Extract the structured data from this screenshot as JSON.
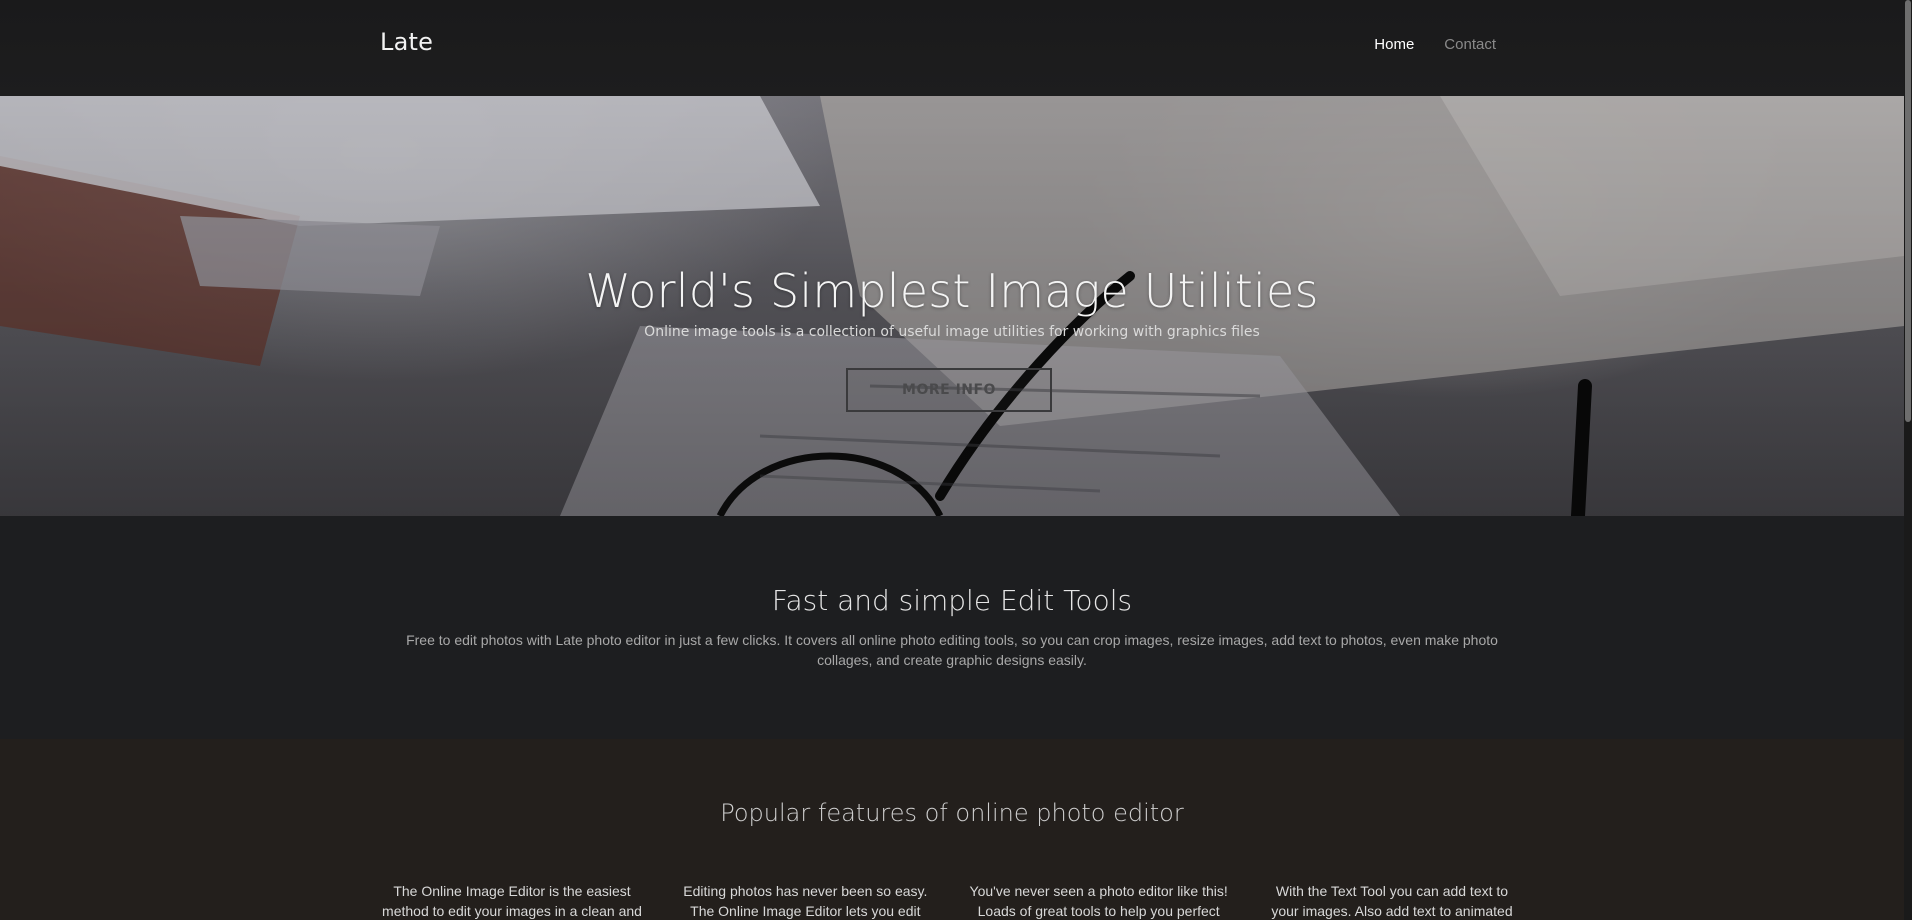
{
  "navbar": {
    "brand": "Late",
    "links": [
      {
        "label": "Home",
        "active": true
      },
      {
        "label": "Contact",
        "active": false
      }
    ]
  },
  "hero": {
    "heading": "World's Simplest Image Utilities",
    "subheading": "Online image tools is a collection of useful image utilities for working with graphics files",
    "button_label": "MORE INFO"
  },
  "tools": {
    "heading": "Fast and simple Edit Tools",
    "text": "Free to edit photos with Late photo editor in just a few clicks. It covers all online photo editing tools, so you can crop images, resize images, add text to photos, even make photo collages, and create graphic designs easily."
  },
  "features": {
    "heading": "Popular features of online photo editor",
    "columns": [
      {
        "line1": "The Online Image Editor is the easiest",
        "line2": "method to edit your images in a clean and"
      },
      {
        "line1": "Editing photos has never been so easy.",
        "line2": "The Online Image Editor lets you edit"
      },
      {
        "line1": "You've never seen a photo editor like this!",
        "line2": "Loads of great tools to help you perfect"
      },
      {
        "line1": "With the Text Tool you can add text to",
        "line2": "your images. Also add text to animated"
      }
    ]
  },
  "colors": {
    "navbar_bg": "#1a1a1b",
    "tools_bg": "#1d1e20",
    "features_bg": "#231f1c"
  }
}
